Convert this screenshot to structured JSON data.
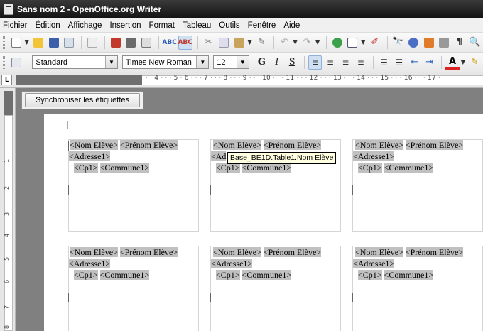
{
  "window": {
    "title": "Sans nom 2 - OpenOffice.org Writer"
  },
  "menu": [
    "Fichier",
    "Édition",
    "Affichage",
    "Insertion",
    "Format",
    "Tableau",
    "Outils",
    "Fenêtre",
    "Aide"
  ],
  "formatting": {
    "style": "Standard",
    "font": "Times New Roman",
    "size": "12",
    "bold": "G",
    "italic": "I",
    "underline": "S"
  },
  "ruler": {
    "marks": "· · 4 · · · 5 · 6 · · · 7 · · · 8 · · · 9 · · · 10 · · · 11 · · · 12 · · · 13 · · · 14 · · · 15 · · · 16 · · · 17 ·"
  },
  "vruler": [
    "1",
    "2",
    "3",
    "4",
    "5",
    "6",
    "7",
    "8"
  ],
  "sync_button": "Synchroniser les étiquettes",
  "tooltip": "Base_BE1D.Table1.Nom Elève",
  "fields": {
    "nom": "<Nom Elève>",
    "prenom": "<Prénom Elève>",
    "adresse": "<Adresse1>",
    "cp": "<Cp1>",
    "commune": "<Commune1>",
    "ad_partial": "<Ad"
  }
}
